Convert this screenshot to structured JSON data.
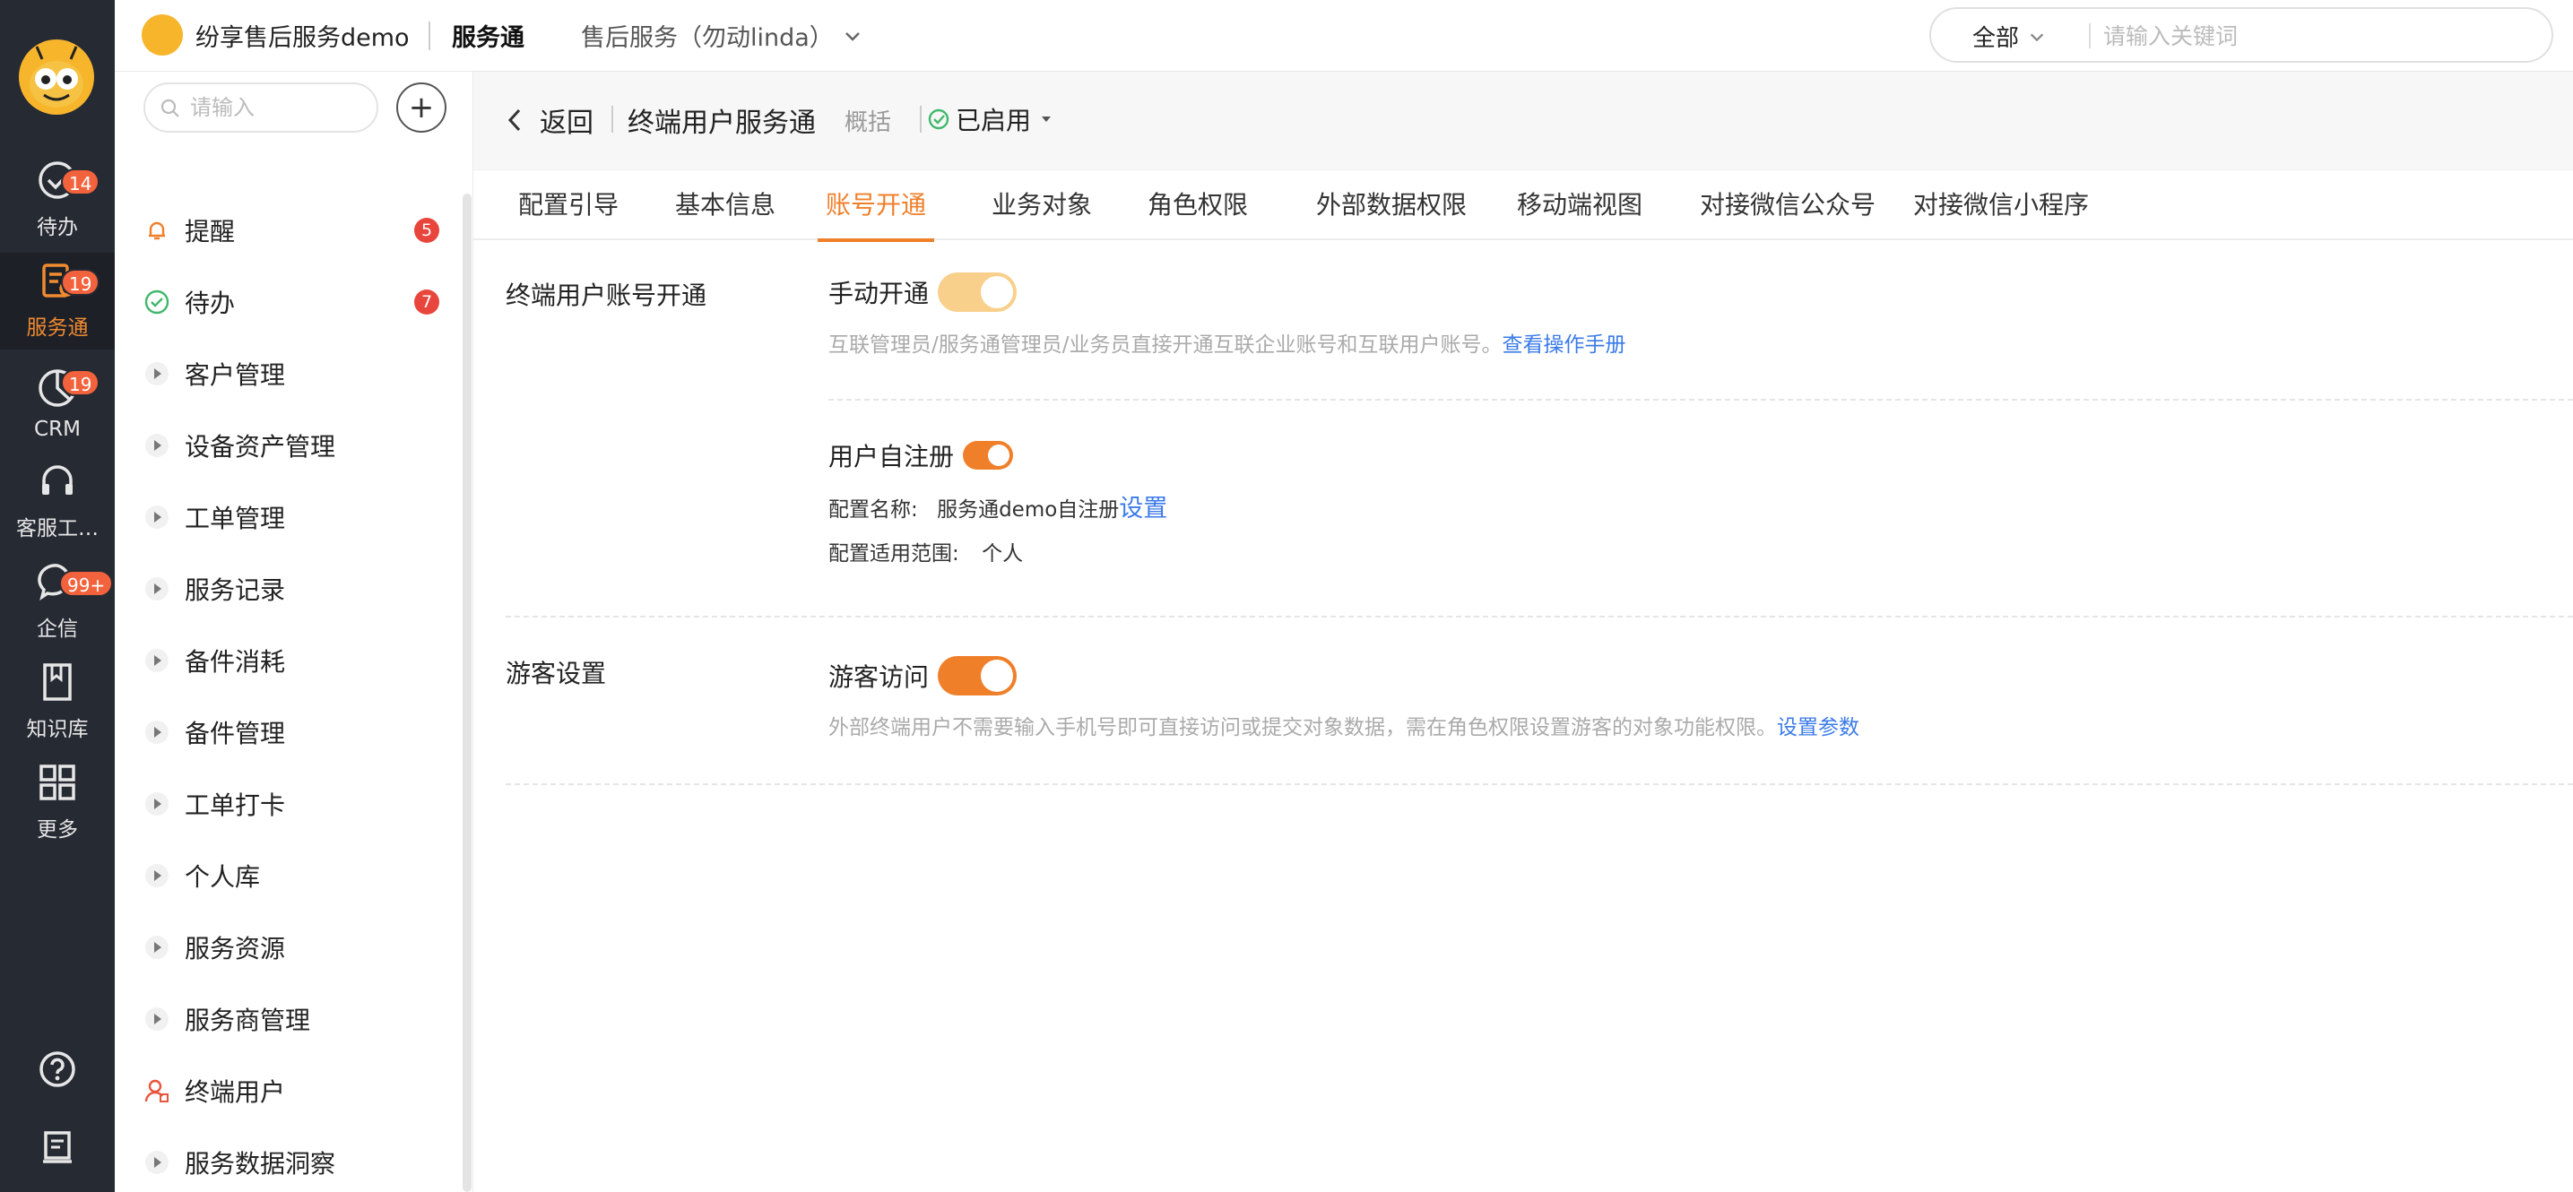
{
  "rail": {
    "items": [
      {
        "label": "待办",
        "badge": "14",
        "icon": "check-circle-icon"
      },
      {
        "label": "服务通",
        "badge": "19",
        "icon": "service-icon"
      },
      {
        "label": "CRM",
        "badge": "19",
        "icon": "pie-icon"
      },
      {
        "label": "客服工…",
        "badge": "",
        "icon": "headset-icon"
      },
      {
        "label": "企信",
        "badge": "99+",
        "icon": "chat-icon"
      },
      {
        "label": "知识库",
        "badge": "",
        "icon": "book-icon"
      },
      {
        "label": "更多",
        "badge": "",
        "icon": "grid-icon"
      }
    ],
    "active_color": "#f08a30"
  },
  "header": {
    "company": "纷享售后服务demo",
    "app_name": "服务通",
    "context": "售后服务（勿动linda）",
    "search_scope": "全部",
    "search_placeholder": "请输入关键词"
  },
  "sidenav": {
    "search_placeholder": "请输入",
    "add_label": "+",
    "items": [
      {
        "label": "提醒",
        "count": "5",
        "type": "bell"
      },
      {
        "label": "待办",
        "count": "7",
        "type": "todo"
      },
      {
        "label": "客户管理",
        "type": "folder"
      },
      {
        "label": "设备资产管理",
        "type": "folder"
      },
      {
        "label": "工单管理",
        "type": "folder"
      },
      {
        "label": "服务记录",
        "type": "folder"
      },
      {
        "label": "备件消耗",
        "type": "folder"
      },
      {
        "label": "备件管理",
        "type": "folder"
      },
      {
        "label": "工单打卡",
        "type": "folder"
      },
      {
        "label": "个人库",
        "type": "folder"
      },
      {
        "label": "服务资源",
        "type": "folder"
      },
      {
        "label": "服务商管理",
        "type": "folder"
      },
      {
        "label": "终端用户",
        "type": "user"
      },
      {
        "label": "服务数据洞察",
        "type": "folder"
      }
    ]
  },
  "page": {
    "back_label": "返回",
    "title": "终端用户服务通",
    "subtitle": "概括",
    "status": "已启用",
    "tabs": [
      "配置引导",
      "基本信息",
      "账号开通",
      "业务对象",
      "角色权限",
      "外部数据权限",
      "移动端视图",
      "对接微信公众号",
      "对接微信小程序"
    ],
    "active_tab": 2,
    "accent": "#f07f2a"
  },
  "account": {
    "section_label": "终端用户账号开通",
    "manual": {
      "label": "手动开通",
      "enabled": true,
      "desc": "互联管理员/服务通管理员/业务员直接开通互联企业账号和互联用户账号。",
      "link": "查看操作手册"
    },
    "self_register": {
      "label": "用户自注册",
      "enabled": true,
      "config_name_label": "配置名称:",
      "config_name_value": "服务通demo自注册",
      "config_link": "设置",
      "scope_label": "配置适用范围:",
      "scope_value": "个人"
    }
  },
  "guest": {
    "section_label": "游客设置",
    "label": "游客访问",
    "enabled": true,
    "desc": "外部终端用户不需要输入手机号即可直接访问或提交对象数据，需在角色权限设置游客的对象功能权限。",
    "link": "设置参数"
  }
}
